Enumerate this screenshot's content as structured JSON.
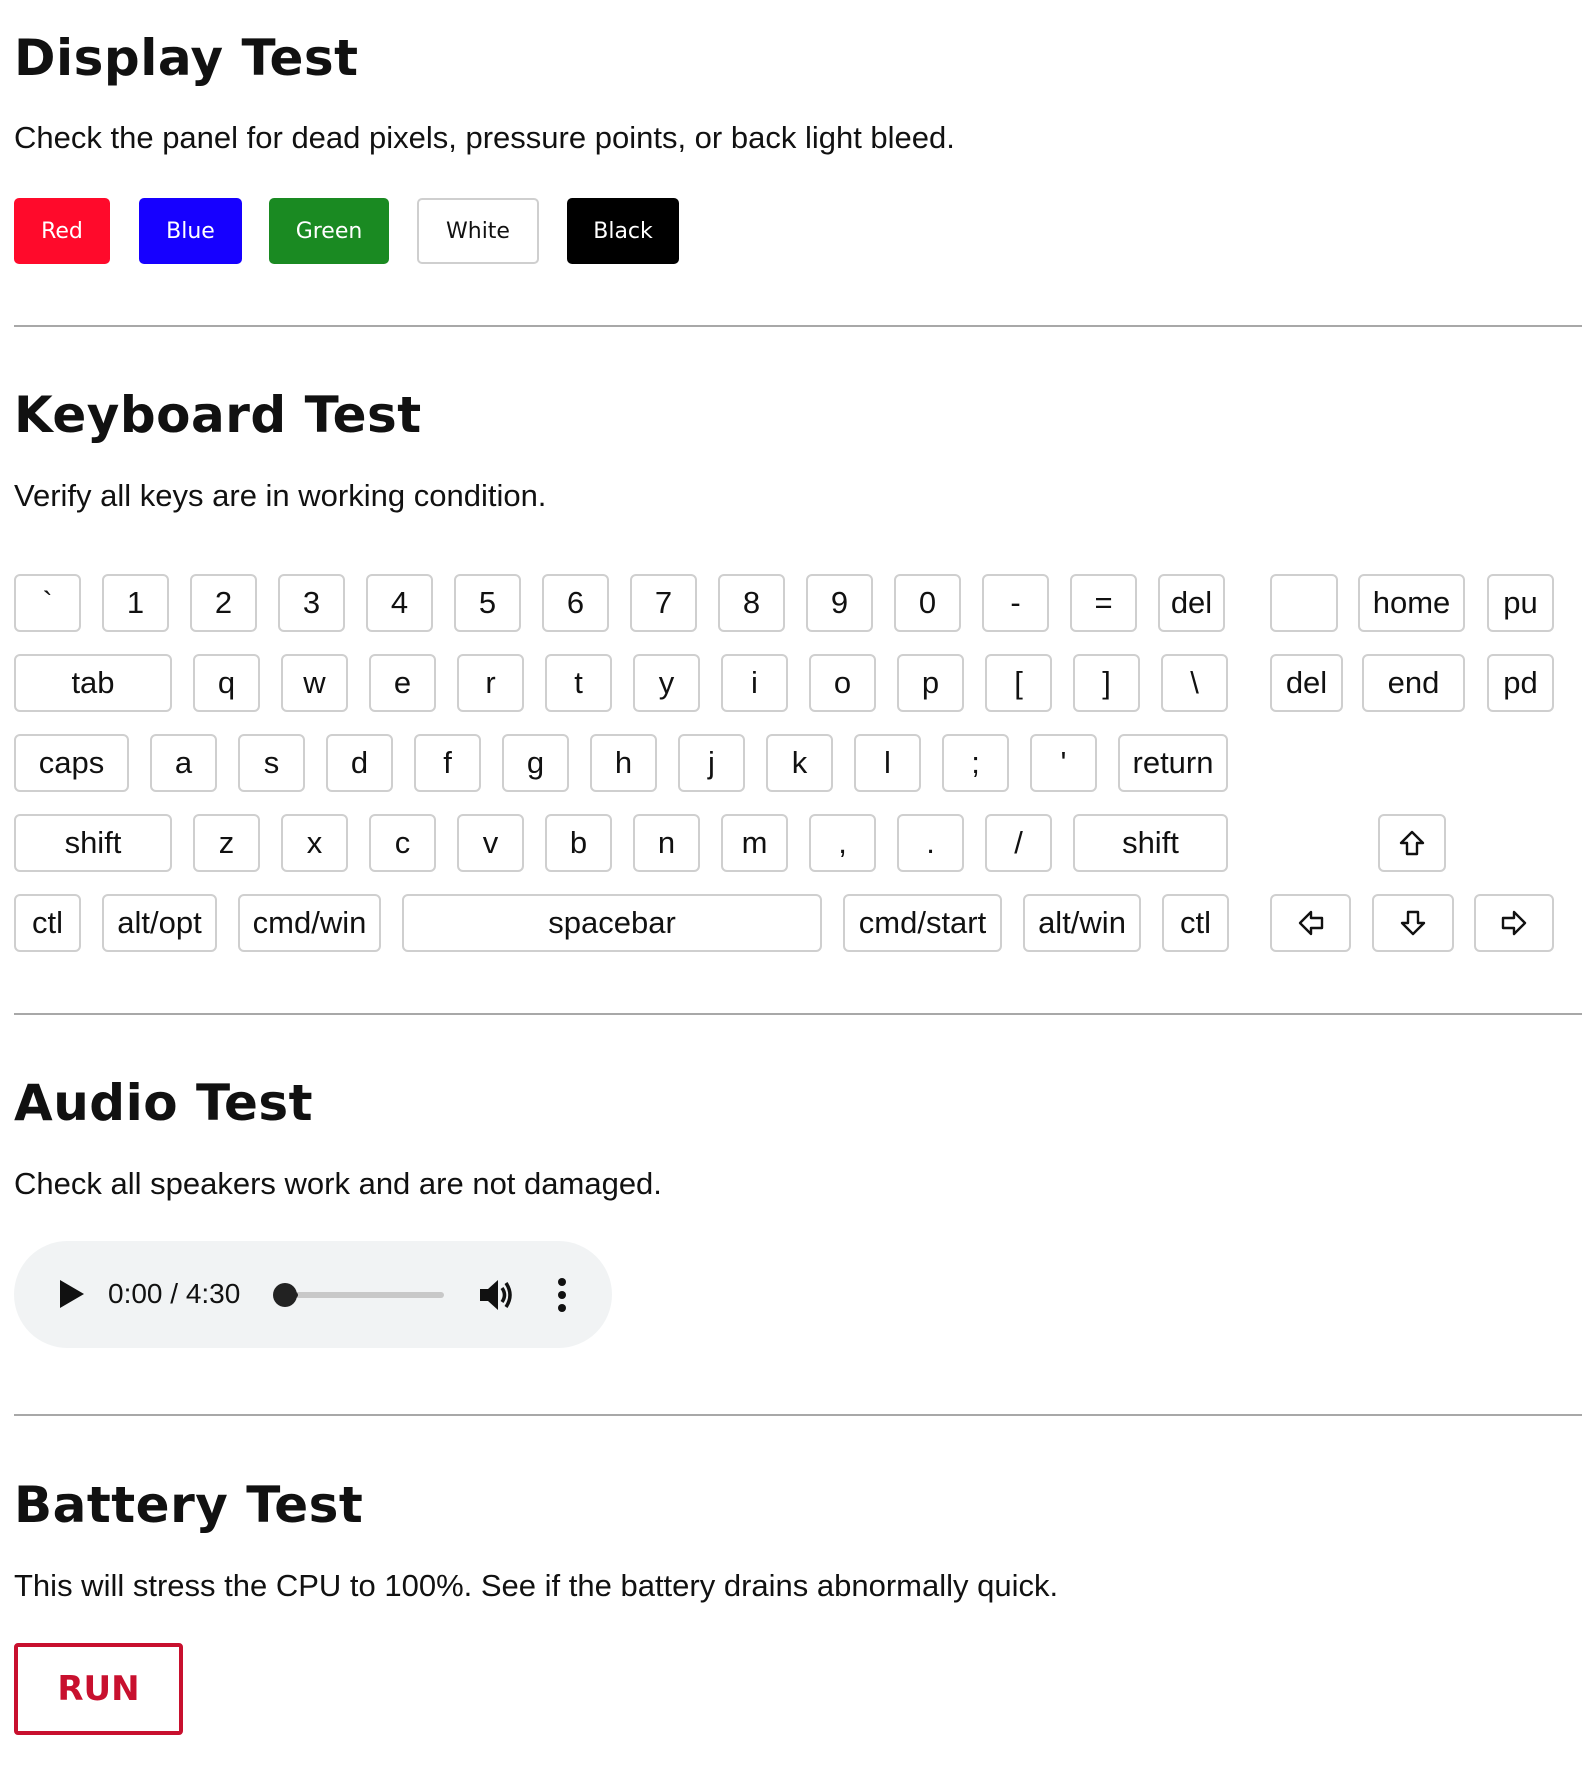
{
  "display": {
    "title": "Display Test",
    "description": "Check the panel for dead pixels, pressure points, or back light bleed.",
    "buttons": [
      {
        "label": "Red",
        "color": "#ff0a2b"
      },
      {
        "label": "Blue",
        "color": "#1600ff"
      },
      {
        "label": "Green",
        "color": "#1a8a22"
      },
      {
        "label": "White",
        "color": "#ffffff"
      },
      {
        "label": "Black",
        "color": "#000000"
      }
    ]
  },
  "keyboard": {
    "title": "Keyboard Test",
    "description": "Verify all keys are in working condition.",
    "row1": [
      "`",
      "1",
      "2",
      "3",
      "4",
      "5",
      "6",
      "7",
      "8",
      "9",
      "0",
      "-",
      "=",
      "del"
    ],
    "row2": [
      "tab",
      "q",
      "w",
      "e",
      "r",
      "t",
      "y",
      "i",
      "o",
      "p",
      "[",
      "]",
      "\\"
    ],
    "row3": [
      "caps",
      "a",
      "s",
      "d",
      "f",
      "g",
      "h",
      "j",
      "k",
      "l",
      ";",
      "'",
      "return"
    ],
    "row4": [
      "shift",
      "z",
      "x",
      "c",
      "v",
      "b",
      "n",
      "m",
      ",",
      ".",
      "/",
      "shift"
    ],
    "row5": [
      "ctl",
      "alt/opt",
      "cmd/win",
      "spacebar",
      "cmd/start",
      "alt/win",
      "ctl"
    ],
    "nav_row1": [
      "",
      "home",
      "pu"
    ],
    "nav_row2": [
      "del",
      "end",
      "pd"
    ],
    "arrow_icons": [
      "arrow-up-icon",
      "arrow-left-icon",
      "arrow-down-icon",
      "arrow-right-icon"
    ]
  },
  "audio": {
    "title": "Audio Test",
    "description": "Check all speakers work and are not damaged.",
    "time": "0:00 / 4:30",
    "progress_fraction": 0.0
  },
  "battery": {
    "title": "Battery Test",
    "description": "This will stress the CPU to 100%. See if the battery drains abnormally quick.",
    "run_label": "RUN",
    "accent": "#c8102e"
  }
}
